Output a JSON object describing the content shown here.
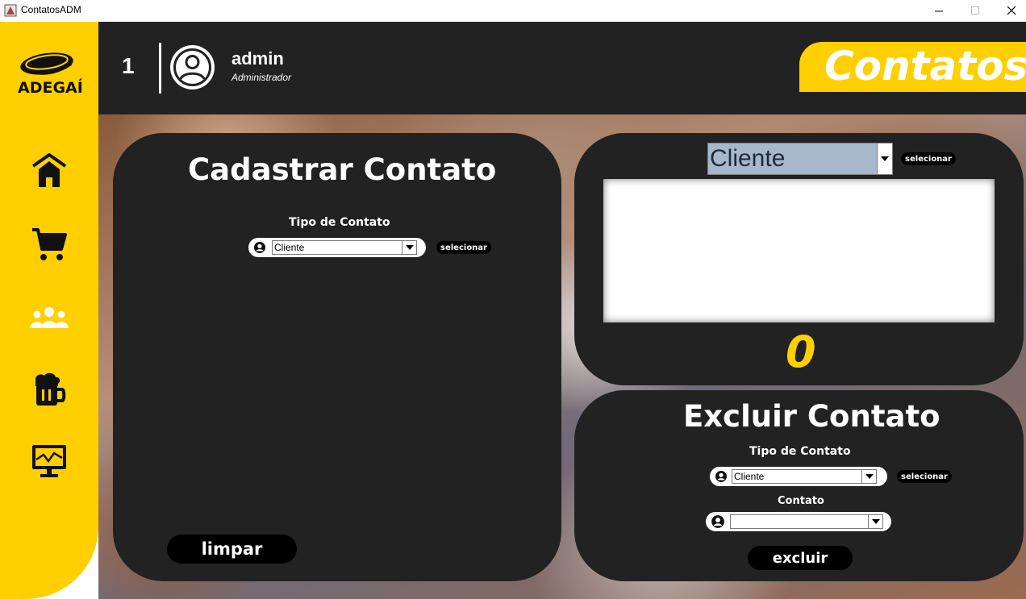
{
  "window": {
    "title": "ContatosADM"
  },
  "colors": {
    "accent": "#ffcf00",
    "panel": "#222222",
    "header": "#222222",
    "button": "#000000",
    "combo_highlight": "#a7b8cd"
  },
  "sidebar": {
    "logo_text": "ADEGAÍ",
    "items": [
      {
        "name": "home",
        "icon": "home-icon"
      },
      {
        "name": "cart",
        "icon": "cart-icon"
      },
      {
        "name": "users",
        "icon": "users-icon"
      },
      {
        "name": "beer",
        "icon": "beer-icon"
      },
      {
        "name": "monitor",
        "icon": "monitor-chart-icon"
      }
    ]
  },
  "header": {
    "user_number": "1",
    "user_name": "admin",
    "user_role": "Administrador",
    "page_title": "Contatos"
  },
  "register": {
    "title": "Cadastrar Contato",
    "type_label": "Tipo de Contato",
    "type_value": "Cliente",
    "select_label": "selecionar",
    "clear_label": "limpar"
  },
  "list": {
    "type_value": "Cliente",
    "select_label": "selecionar",
    "count": "0"
  },
  "delete": {
    "title": "Excluir Contato",
    "type_label": "Tipo de Contato",
    "type_value": "Cliente",
    "select_label": "selecionar",
    "contact_label": "Contato",
    "contact_value": "",
    "delete_label": "excluir"
  }
}
